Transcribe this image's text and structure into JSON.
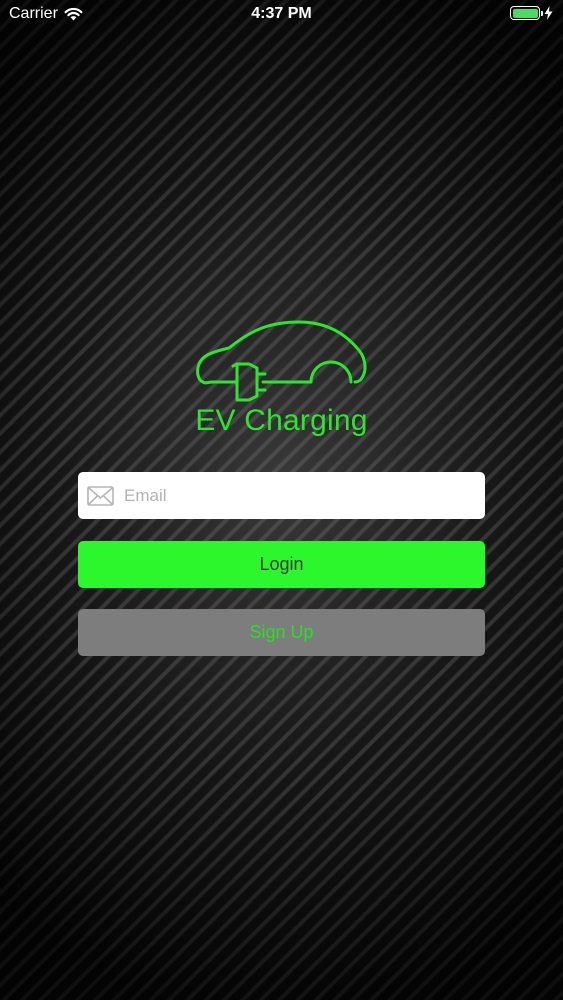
{
  "status_bar": {
    "carrier": "Carrier",
    "time": "4:37 PM",
    "battery_level": 1.0,
    "icons": [
      "wifi-icon",
      "battery-icon",
      "charging-bolt-icon"
    ]
  },
  "logo": {
    "text": "EV Charging",
    "icon": "electric-car-plug-icon",
    "color": "#2ee52e"
  },
  "form": {
    "email": {
      "placeholder": "Email",
      "value": "",
      "icon": "mail-icon"
    },
    "login_label": "Login",
    "signup_label": "Sign Up"
  },
  "colors": {
    "accent": "#2cf72c",
    "signup_background": "#7d7d7d",
    "signup_text": "#27e027"
  }
}
